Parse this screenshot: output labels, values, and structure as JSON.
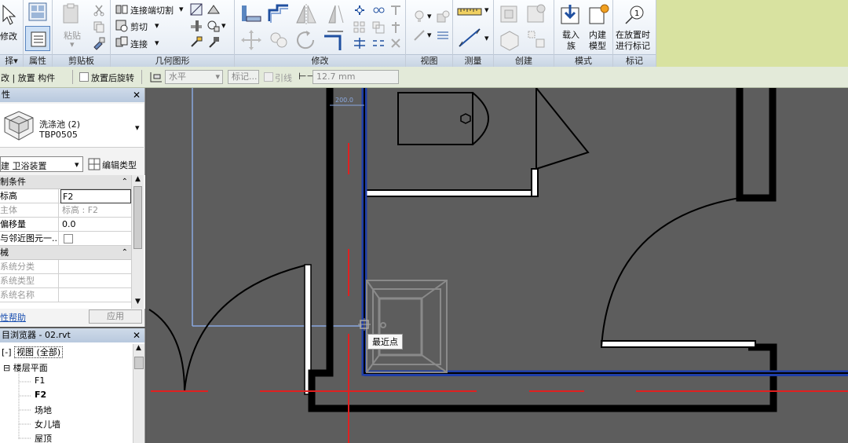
{
  "ribbon": {
    "left_partial": {
      "modify_label": "修改",
      "select_label": "择",
      "select_arrow": "▾",
      "properties_label": "属性"
    },
    "clipboard": {
      "paste_label": "粘贴",
      "title": "剪贴板"
    },
    "geometry": {
      "connect_end_cut": "连接端切割",
      "cut": "剪切",
      "join": "连接",
      "title": "几何图形"
    },
    "modify": {
      "title": "修改"
    },
    "view": {
      "title": "视图"
    },
    "measure": {
      "title": "测量"
    },
    "create": {
      "title": "创建"
    },
    "mode": {
      "load_family_1": "载入",
      "load_family_2": "族",
      "in_place_1": "内建",
      "in_place_2": "模型",
      "title": "模式"
    },
    "tag": {
      "tag_on_place_1": "在放置时",
      "tag_on_place_2": "进行标记",
      "title": "标记",
      "tag_number": "1"
    }
  },
  "options_bar": {
    "context": "改 | 放置 构件",
    "rotate_after_place": "放置后旋转",
    "orientation": "水平",
    "tag_placeholder": "标记...",
    "leader": "引线",
    "leader_length": "12.7 mm"
  },
  "properties": {
    "title": "性",
    "close": "✕",
    "type_name": "洗涤池 (2)",
    "type_sub": "TBP0505",
    "category_select": "建 卫浴装置",
    "edit_type": "编辑类型",
    "sections": [
      {
        "title": "制条件",
        "rows": [
          {
            "k": "标高",
            "v": "F2",
            "editable": true
          },
          {
            "k": "主体",
            "v": "标高 : F2",
            "editable": false
          },
          {
            "k": "偏移量",
            "v": "0.0",
            "editable": true
          },
          {
            "k": "与邻近图元一...",
            "v": "",
            "editable": true
          }
        ]
      },
      {
        "title": "械",
        "rows": [
          {
            "k": "系统分类",
            "v": "",
            "editable": false
          },
          {
            "k": "系统类型",
            "v": "",
            "editable": false
          },
          {
            "k": "系统名称",
            "v": "",
            "editable": false
          }
        ]
      }
    ],
    "help_link": "性帮助",
    "apply": "应用"
  },
  "browser": {
    "title": "目浏览器 - 02.rvt",
    "close": "✕",
    "items": [
      {
        "label": "视图 (全部)",
        "level": 0,
        "toggle": "[-]",
        "bold": false
      },
      {
        "label": "楼层平面",
        "level": 1,
        "toggle": "⊟",
        "bold": false
      },
      {
        "label": "F1",
        "level": 2,
        "toggle": "",
        "bold": false
      },
      {
        "label": "F2",
        "level": 2,
        "toggle": "",
        "bold": true
      },
      {
        "label": "场地",
        "level": 2,
        "toggle": "",
        "bold": false
      },
      {
        "label": "女儿墙",
        "level": 2,
        "toggle": "",
        "bold": false
      },
      {
        "label": "屋顶",
        "level": 2,
        "toggle": "",
        "bold": false
      }
    ]
  },
  "canvas": {
    "snap_tooltip": "最近点",
    "dimension_text": "200.0",
    "colors": {
      "wall": "#000000",
      "selected_wall": "#1f3ea8",
      "ref_line": "#e02020",
      "preview": "#8a8a8a",
      "wall_fill": "#ffffff",
      "crop": "#8aa8e0"
    }
  }
}
